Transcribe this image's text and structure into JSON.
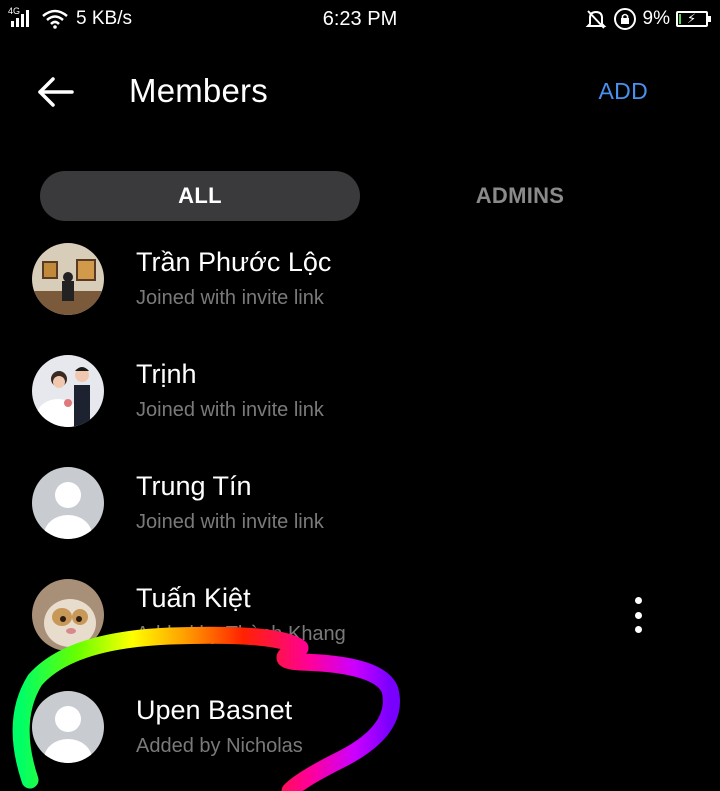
{
  "status_bar": {
    "network": "4G",
    "speed": "5 KB/s",
    "time": "6:23 PM",
    "battery_percent": "9%",
    "battery_level": 0.09,
    "icons": [
      "signal-icon",
      "wifi-icon",
      "mute-bell-icon",
      "rotation-lock-icon",
      "battery-charging-icon"
    ]
  },
  "header": {
    "back_icon": "arrow-left-icon",
    "title": "Members",
    "add_label": "ADD",
    "accent_color": "#4a90f0"
  },
  "tabs": [
    {
      "label": "ALL",
      "selected": true
    },
    {
      "label": "ADMINS",
      "selected": false
    }
  ],
  "members": [
    {
      "name": "Trần Phước Lộc",
      "subtitle": "Joined with invite link",
      "avatar": "photo-gallery-avatar"
    },
    {
      "name": "Trịnh",
      "subtitle": "Joined with invite link",
      "avatar": "photo-wedding-avatar"
    },
    {
      "name": "Trung Tín",
      "subtitle": "Joined with invite link",
      "avatar": "default-person-avatar"
    },
    {
      "name": "Tuấn Kiệt",
      "subtitle": "Added by Thành Khang",
      "avatar": "photo-cat-avatar"
    },
    {
      "name": "Upen Basnet",
      "subtitle": "Added by Nicholas",
      "avatar": "default-person-avatar"
    }
  ],
  "more_icon": "more-vertical-icon"
}
